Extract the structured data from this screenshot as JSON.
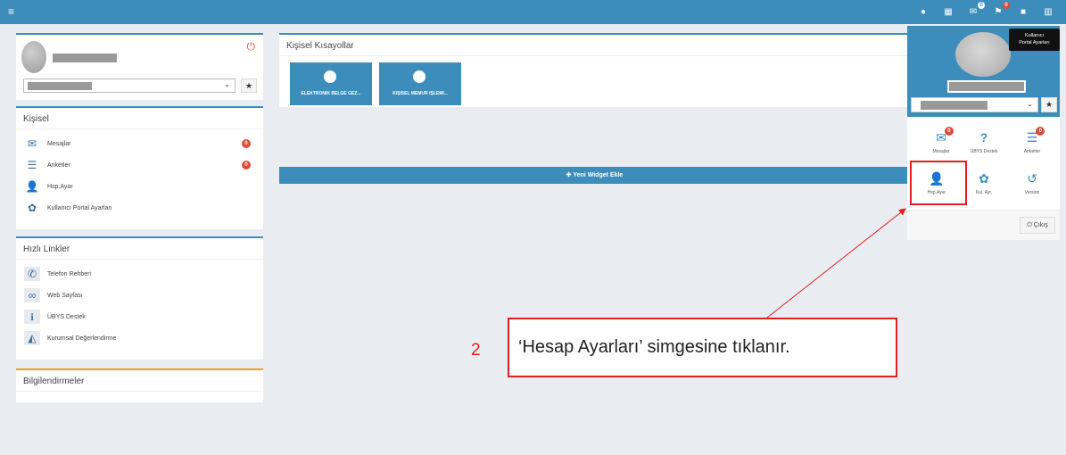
{
  "topbar": {
    "menu_icon": "bars-icon",
    "icons": [
      {
        "name": "globe-icon",
        "glyph": "●",
        "badge": ""
      },
      {
        "name": "calendar-icon",
        "glyph": "▦",
        "badge": ""
      },
      {
        "name": "comments-icon",
        "glyph": "✉",
        "badge": "0"
      },
      {
        "name": "flag-icon",
        "glyph": "⚑",
        "badge": "0"
      },
      {
        "name": "lock-icon",
        "glyph": "■",
        "badge": ""
      },
      {
        "name": "grid-icon",
        "glyph": "▥",
        "badge": ""
      }
    ]
  },
  "profile": {
    "star": "★",
    "chevron": "⌄"
  },
  "kisisel": {
    "title": "Kişisel",
    "items": [
      {
        "label": "Mesajlar",
        "icon": "envelope-icon",
        "badge": "0"
      },
      {
        "label": "Anketler",
        "icon": "list-icon",
        "badge": "0"
      },
      {
        "label": "Hsp.Ayar",
        "icon": "user-icon",
        "badge": ""
      },
      {
        "label": "Kullanıcı Portal Ayarları",
        "icon": "gear-icon",
        "badge": ""
      }
    ]
  },
  "hizli": {
    "title": "Hızlı Linkler",
    "items": [
      {
        "label": "Telefon Rehberi",
        "icon": "phone-icon"
      },
      {
        "label": "Web Sayfası",
        "icon": "link-icon"
      },
      {
        "label": "ÜBYS Destek",
        "icon": "info-icon"
      },
      {
        "label": "Kurumsal Değerlendirme",
        "icon": "area-chart-icon"
      }
    ]
  },
  "bilgi": {
    "title": "Bilgilendirmeler"
  },
  "shortcuts": {
    "title": "Kişisel Kısayollar",
    "tiles": [
      {
        "label": "ELEKTRONİK BELGE GEZ..."
      },
      {
        "label": "KİŞİSEL MEMUR İŞLEMİ..."
      }
    ]
  },
  "widget": {
    "add_label": "✚ Yeni Widget Ekle"
  },
  "dropdown": {
    "cells": [
      {
        "label": "Mesajlar",
        "icon": "envelope-icon",
        "glyph": "✉",
        "badge": "0"
      },
      {
        "label": "ÜBYS Destek",
        "icon": "question-icon",
        "glyph": "?",
        "badge": ""
      },
      {
        "label": "Anketler",
        "icon": "list-icon",
        "glyph": "☰",
        "badge": "0"
      },
      {
        "label": "Hsp.Ayar",
        "icon": "user-icon",
        "glyph": "👤",
        "badge": ""
      },
      {
        "label": "Kul. Ayr.",
        "icon": "gear-icon",
        "glyph": "✿",
        "badge": ""
      },
      {
        "label": "Version",
        "icon": "history-icon",
        "glyph": "↺",
        "badge": ""
      }
    ],
    "logout_label": "⏻ Çıkış"
  },
  "tooltip": {
    "line1": "Kullanıcı",
    "line2": "Portal Ayarları"
  },
  "callout": {
    "number": "2",
    "text": "‘Hesap Ayarları’ simgesine tıklanır."
  },
  "colors": {
    "brand": "#3c8dbc",
    "badge": "#dd4b39",
    "annotation": "#e02020"
  }
}
